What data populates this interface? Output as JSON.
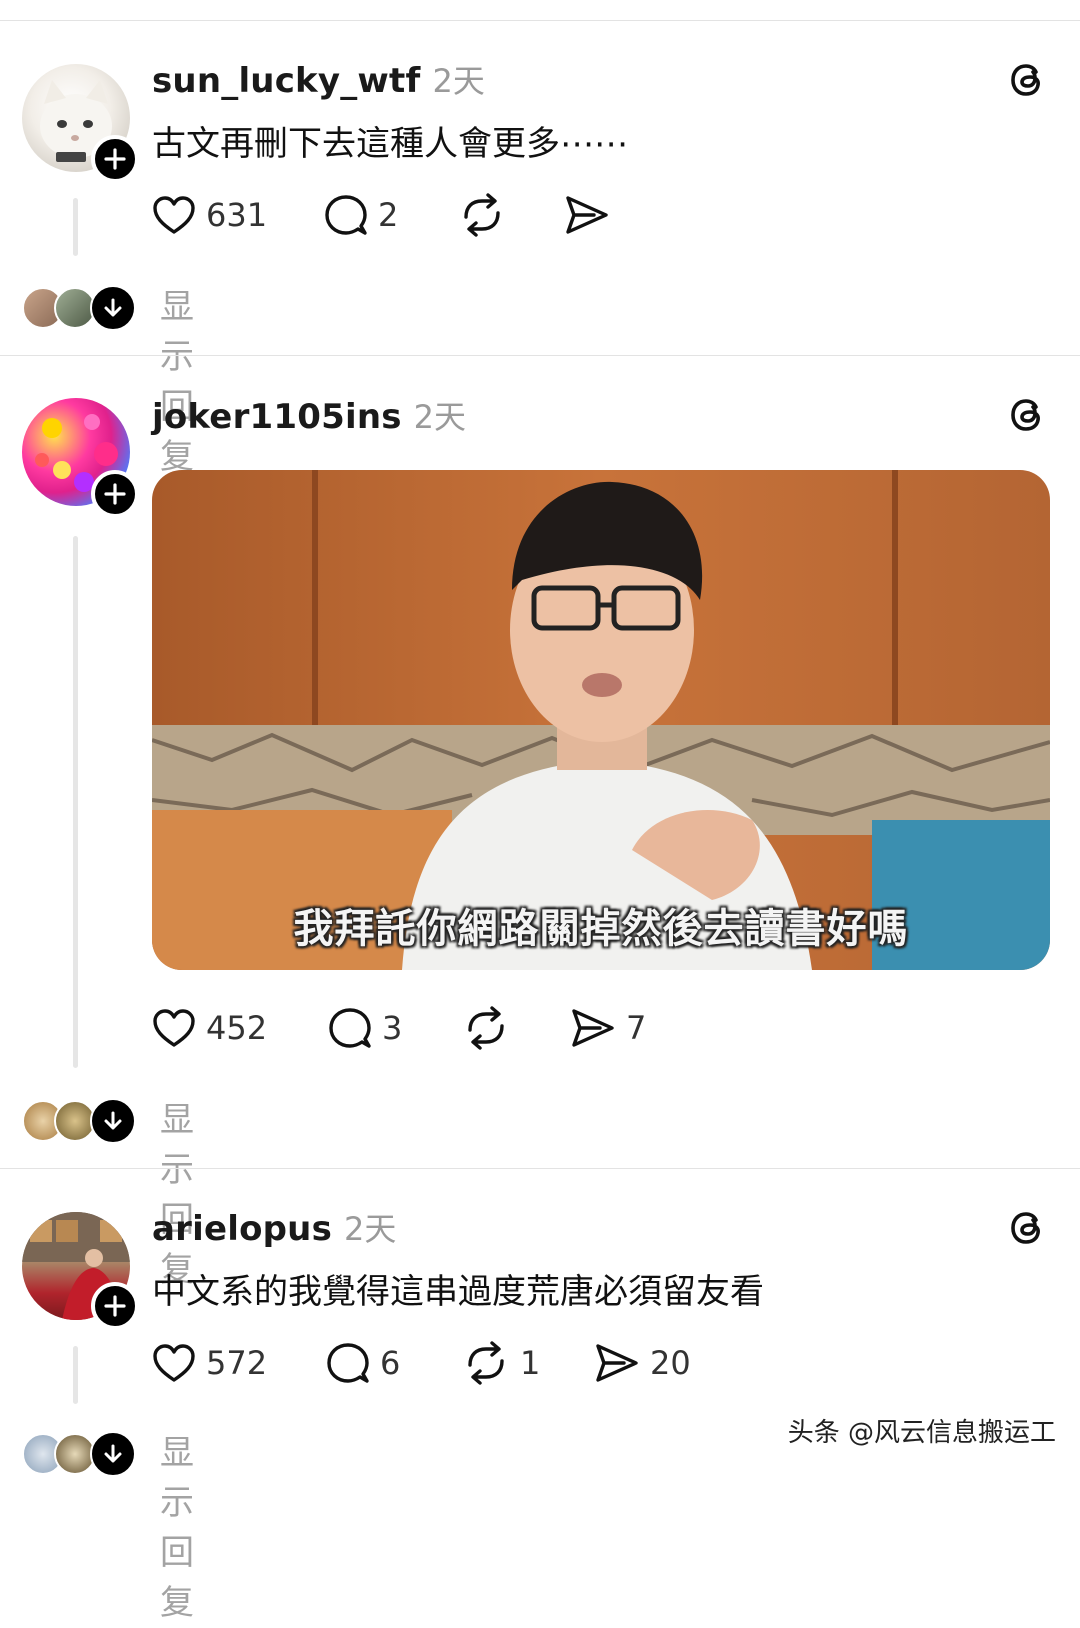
{
  "posts": [
    {
      "username": "sun_lucky_wtf",
      "time": "2天",
      "text": "古文再刪下去這種人會更多⋯⋯",
      "likes": "631",
      "comments": "2",
      "reposts": "",
      "shares": "",
      "show_replies": "显示回复"
    },
    {
      "username": "joker1105ins",
      "time": "2天",
      "video_subtitle": "我拜託你網路關掉然後去讀書好嗎",
      "likes": "452",
      "comments": "3",
      "reposts": "",
      "shares": "7",
      "show_replies": "显示回复"
    },
    {
      "username": "arielopus",
      "time": "2天",
      "text": "中文系的我覺得這串過度荒唐必須留友看",
      "likes": "572",
      "comments": "6",
      "reposts": "1",
      "shares": "20",
      "show_replies": "显示回复"
    }
  ],
  "watermark": "头条 @风云信息搬运工",
  "colors": {
    "text": "#111111",
    "muted": "#9a9a9a",
    "divider": "#e3e3e3"
  },
  "icons": [
    "heart-icon",
    "comment-icon",
    "repost-icon",
    "share-icon",
    "threads-logo-icon",
    "follow-plus-icon",
    "arrow-down-icon"
  ]
}
